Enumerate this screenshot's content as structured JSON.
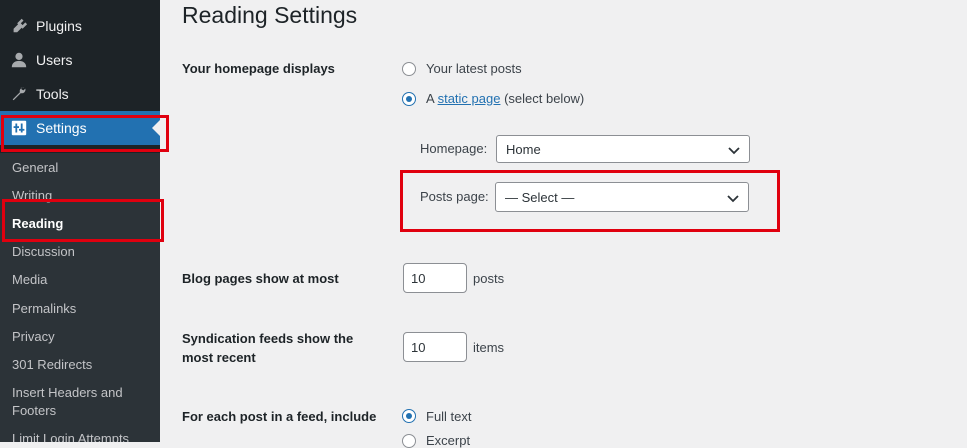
{
  "sidebar": {
    "menu": [
      {
        "label": "Plugins",
        "icon": "plugin-icon"
      },
      {
        "label": "Users",
        "icon": "users-icon"
      },
      {
        "label": "Tools",
        "icon": "wrench-icon"
      },
      {
        "label": "Settings",
        "icon": "settings-icon"
      }
    ],
    "submenu": [
      "General",
      "Writing",
      "Reading",
      "Discussion",
      "Media",
      "Permalinks",
      "Privacy",
      "301 Redirects",
      "Insert Headers and Footers",
      "Limit Login Attempts"
    ]
  },
  "page": {
    "title": "Reading Settings",
    "homepage_displays": {
      "label": "Your homepage displays",
      "option_latest": "Your latest posts",
      "option_static_prefix": "A ",
      "option_static_link": "static page",
      "option_static_suffix": " (select below)",
      "homepage_label": "Homepage:",
      "homepage_value": "Home",
      "posts_page_label": "Posts page:",
      "posts_page_value": "— Select —"
    },
    "blog_pages": {
      "label": "Blog pages show at most",
      "value": "10",
      "unit": "posts"
    },
    "syndication": {
      "label": "Syndication feeds show the most recent",
      "value": "10",
      "unit": "items"
    },
    "feed_include": {
      "label": "For each post in a feed, include",
      "option_full": "Full text",
      "option_excerpt": "Excerpt"
    }
  },
  "colors": {
    "accent": "#2271b1",
    "highlight": "#e0000f",
    "sidebar": "#1d2327"
  }
}
